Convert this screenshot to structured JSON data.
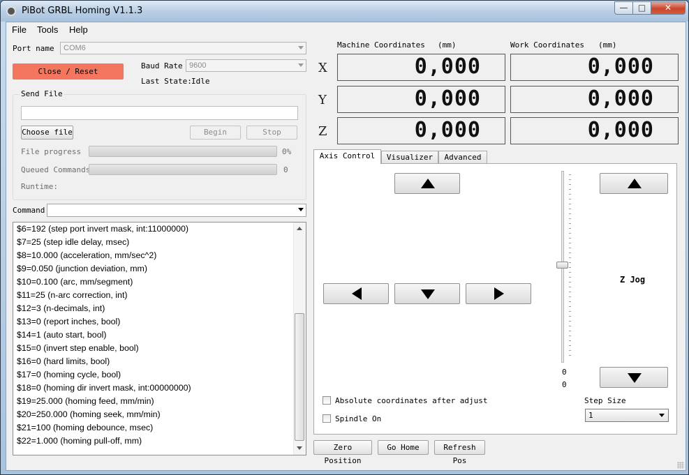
{
  "window": {
    "title": "PiBot GRBL Homing V1.1.3",
    "minimize_glyph": "—",
    "maximize_glyph": "□",
    "close_glyph": "✕"
  },
  "menu": [
    "File",
    "Tools",
    "Help"
  ],
  "connection": {
    "port_label": "Port name",
    "port_value": "COM6",
    "baud_label": "Baud Rate",
    "baud_value": "9600",
    "close_reset_label": "Close / Reset",
    "state_label": "Last State:",
    "state_value": "Idle"
  },
  "send_file": {
    "group_label": "Send File",
    "file_path": "",
    "choose_label": "Choose file",
    "begin_label": "Begin",
    "stop_label": "Stop",
    "file_progress_label": "File progress",
    "file_progress_value": "0%",
    "file_progress_fraction": 0,
    "queued_label": "Queued Commands",
    "queued_value": "0",
    "runtime_label": "Runtime:"
  },
  "command": {
    "label": "Command",
    "value": ""
  },
  "console_lines": [
    "$6=192 (step port invert mask, int:11000000)",
    "$7=25 (step idle delay, msec)",
    "$8=10.000 (acceleration, mm/sec^2)",
    "$9=0.050 (junction deviation, mm)",
    "$10=0.100 (arc, mm/segment)",
    "$11=25 (n-arc correction, int)",
    "$12=3 (n-decimals, int)",
    "$13=0 (report inches, bool)",
    "$14=1 (auto start, bool)",
    "$15=0 (invert step enable, bool)",
    "$16=0 (hard limits, bool)",
    "$17=0 (homing cycle, bool)",
    "$18=0 (homing dir invert mask, int:00000000)",
    "$19=25.000 (homing feed, mm/min)",
    "$20=250.000 (homing seek, mm/min)",
    "$21=100 (homing debounce, msec)",
    "$22=1.000 (homing pull-off, mm)"
  ],
  "coordinates": {
    "machine_label": "Machine Coordinates",
    "work_label": "Work Coordinates",
    "unit": "(mm)",
    "axes": [
      {
        "letter": "X",
        "machine": "0,000",
        "work": "0,000"
      },
      {
        "letter": "Y",
        "machine": "0,000",
        "work": "0,000"
      },
      {
        "letter": "Z",
        "machine": "0,000",
        "work": "0,000"
      }
    ]
  },
  "tabs": [
    "Axis Control",
    "Visualizer",
    "Advanced"
  ],
  "axis_control": {
    "z_jog_label": "Z Jog",
    "slider_min_label": "0",
    "slider_value_label": "0",
    "absolute_label": "Absolute coordinates after adjust",
    "spindle_label": "Spindle On",
    "step_size_label": "Step Size",
    "step_size_value": "1"
  },
  "bottom_buttons": {
    "zero": "Zero Position",
    "home": "Go Home",
    "refresh": "Refresh Pos"
  }
}
